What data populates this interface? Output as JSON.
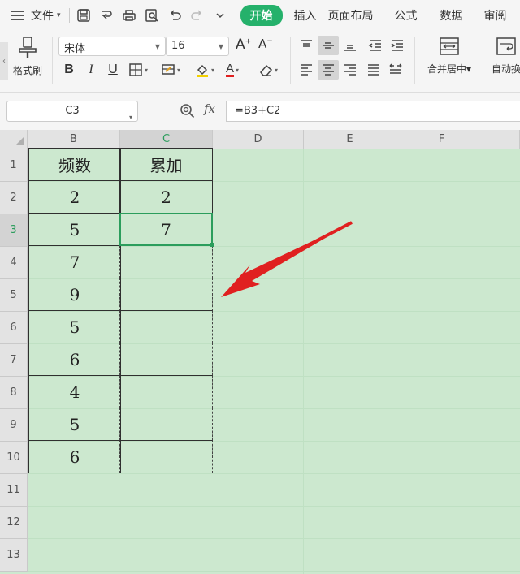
{
  "menubar": {
    "file_label": "文件",
    "tabs": [
      "开始",
      "插入",
      "页面布局",
      "公式",
      "数据",
      "审阅"
    ]
  },
  "ribbon": {
    "format_painter": "格式刷",
    "font_name": "宋体",
    "font_size": "16",
    "grow_font": "A",
    "shrink_font": "A",
    "bold": "B",
    "italic": "I",
    "underline": "U",
    "merge_center": "合并居中",
    "auto_wrap": "自动换",
    "merge_dd": "▾"
  },
  "formula_bar": {
    "cell_ref": "C3",
    "fx": "fx",
    "formula": "=B3+C2"
  },
  "grid": {
    "columns": [
      "B",
      "C",
      "D",
      "E",
      "F"
    ],
    "active_column": "C",
    "rows": [
      "1",
      "2",
      "3",
      "4",
      "5",
      "6",
      "7",
      "8",
      "9",
      "10",
      "11",
      "12",
      "13"
    ],
    "active_row": "3",
    "table": {
      "headers": [
        "频数",
        "累加"
      ],
      "B": [
        "2",
        "5",
        "7",
        "9",
        "5",
        "6",
        "4",
        "5",
        "6"
      ],
      "C": [
        "2",
        "7",
        "",
        "",
        "",
        "",
        "",
        "",
        ""
      ]
    }
  },
  "colors": {
    "accent": "#2b9d5c",
    "sheet_bg": "#cce8cf",
    "arrow": "#e02020"
  }
}
